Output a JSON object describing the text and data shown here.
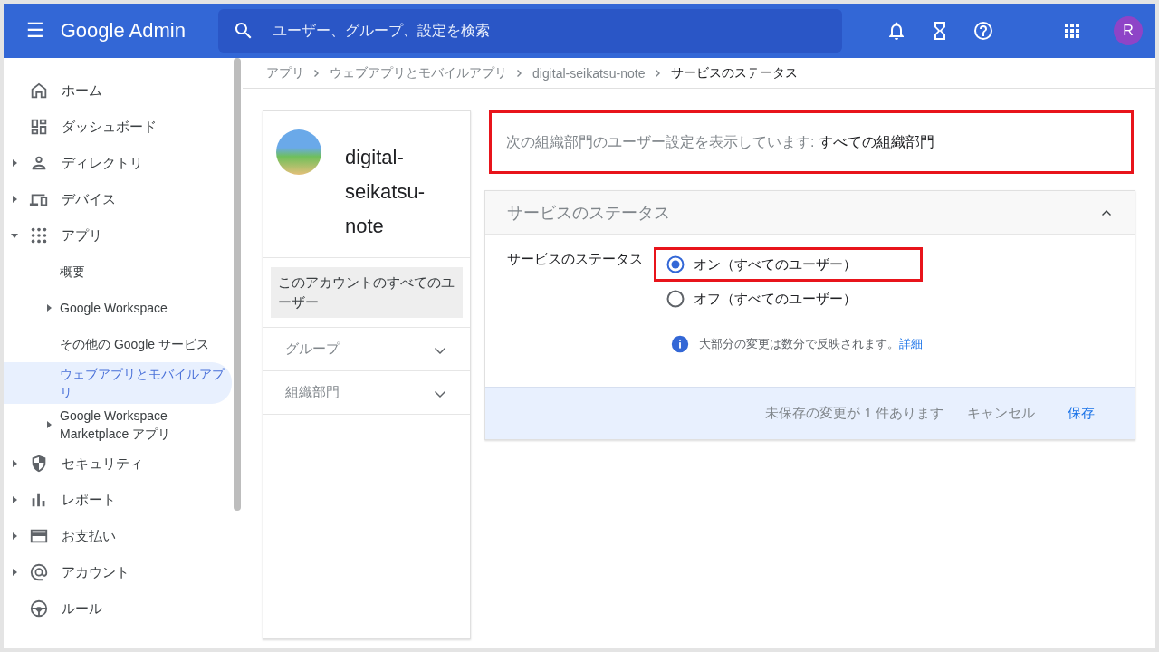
{
  "app_bar": {
    "menu_icon": "☰",
    "title": "Google Admin",
    "search": {
      "placeholder": "ユーザー、グループ、設定を検索"
    },
    "avatar_letter": "R"
  },
  "sidebar": {
    "items": [
      {
        "label": "ホーム",
        "selected": false
      },
      {
        "label": "ダッシュボード",
        "selected": false
      },
      {
        "label": "ディレクトリ",
        "expanded": false,
        "selected": false
      },
      {
        "label": "デバイス",
        "expanded": false,
        "selected": false
      },
      {
        "label": "アプリ",
        "expanded": true,
        "selected": false,
        "children": [
          {
            "label": "概要",
            "selected": false
          },
          {
            "label": "Google Workspace",
            "expanded": false,
            "selected": false
          },
          {
            "label": "その他の Google サービス",
            "selected": false
          },
          {
            "label": "ウェブアプリとモバイルアプリ",
            "selected": true
          },
          {
            "label": "Google Workspace Marketplace アプリ",
            "expanded": false,
            "selected": false
          }
        ]
      },
      {
        "label": "セキュリティ",
        "expanded": false,
        "selected": false
      },
      {
        "label": "レポート",
        "expanded": false,
        "selected": false
      },
      {
        "label": "お支払い",
        "expanded": false,
        "selected": false
      },
      {
        "label": "アカウント",
        "expanded": false,
        "selected": false
      },
      {
        "label": "ルール",
        "selected": false
      }
    ]
  },
  "breadcrumbs": [
    {
      "label": "アプリ",
      "current": false
    },
    {
      "label": "ウェブアプリとモバイルアプリ",
      "current": false
    },
    {
      "label": "digital-seikatsu-note",
      "current": false
    },
    {
      "label": "サービスのステータス",
      "current": true
    }
  ],
  "app_card": {
    "name": "digital-seikatsu-note",
    "scopes": [
      {
        "label": "このアカウントのすべてのユーザー",
        "selected": true,
        "expandable": false
      },
      {
        "label": "グループ",
        "selected": false,
        "expandable": true
      },
      {
        "label": "組織部門",
        "selected": false,
        "expandable": true
      }
    ]
  },
  "org_notice": {
    "label": "次の組織部門のユーザー設定を表示しています:",
    "value": "すべての組織部門",
    "highlighted": true
  },
  "section": {
    "title": "サービスのステータス",
    "expanded": true,
    "field_label": "サービスのステータス",
    "options": [
      {
        "label": "オン（すべてのユーザー）",
        "selected": true,
        "highlighted": true
      },
      {
        "label": "オフ（すべてのユーザー）",
        "selected": false,
        "highlighted": false
      }
    ],
    "info": {
      "text": "大部分の変更は数分で反映されます。",
      "link": "詳細"
    },
    "footer": {
      "unsaved": "未保存の変更が 1 件あります",
      "cancel": "キャンセル",
      "save": "保存"
    }
  }
}
